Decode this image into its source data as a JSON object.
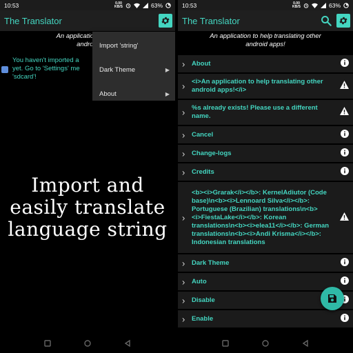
{
  "left": {
    "status": {
      "time": "10:53",
      "speed_value": "0.00",
      "speed_unit": "KB/S",
      "battery": "63%"
    },
    "toolbar": {
      "title": "The Translator"
    },
    "subtitle": {
      "line1": "An application to help",
      "line2": "android"
    },
    "notice": {
      "line1": "You haven't imported a",
      "line2": "yet. Go to 'Settings' me",
      "line3": "'sdcard'!"
    },
    "menu": {
      "items": [
        {
          "label": "Import 'string'",
          "submenu": false
        },
        {
          "label": "Dark Theme",
          "submenu": true
        },
        {
          "label": "About",
          "submenu": true
        }
      ]
    },
    "promo": {
      "line1": "Import and",
      "line2": "easily translate",
      "line3": "language string"
    }
  },
  "right": {
    "status": {
      "time": "10:53",
      "speed_value": "0.00",
      "speed_unit": "KB/S",
      "battery": "63%"
    },
    "toolbar": {
      "title": "The Translator"
    },
    "subtitle": {
      "line1": "An application to help translating other",
      "line2": "android apps!"
    },
    "rows": [
      {
        "label": "About",
        "icon": "info-icon"
      },
      {
        "label": "<i>An application to help translating other android apps!</i>",
        "icon": "warning-icon"
      },
      {
        "label": "%s already exists! Please use a different name.",
        "icon": "warning-icon"
      },
      {
        "label": "Cancel",
        "icon": "info-icon"
      },
      {
        "label": "Change-logs",
        "icon": "info-icon"
      },
      {
        "label": "Credits",
        "icon": "info-icon"
      },
      {
        "label": "<b><i>Grarak</i></b>: KernelAdiutor (Code base)\\n<b><i>Lennoard Silva</i></b>: Portuguese (Brazilian) translations\\n<b><i>FiestaLake</i></b>: Korean translations\\n<b><i>elea11</i></b>: German translations\\n<b><i>Andi Krisma</i></b>: Indonesian translations",
        "icon": "warning-icon"
      },
      {
        "label": "Dark Theme",
        "icon": "info-icon"
      },
      {
        "label": "Auto",
        "icon": "info-icon"
      },
      {
        "label": "Disable",
        "icon": "info-icon"
      },
      {
        "label": "Enable",
        "icon": "info-icon"
      }
    ]
  },
  "colors": {
    "accent": "#44d6c1",
    "fab": "#2fb9a6",
    "row_bg": "#1b1b1b",
    "toolbar_bg": "#1f1f1f"
  }
}
